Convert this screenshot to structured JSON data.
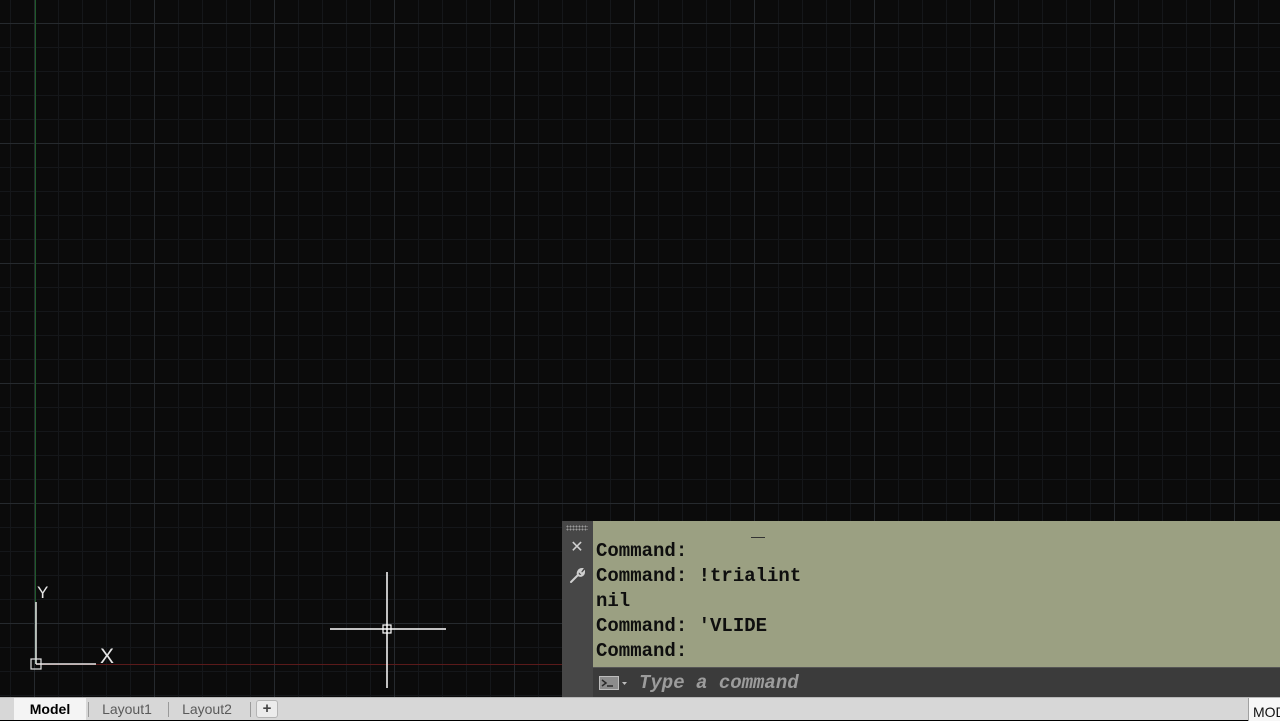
{
  "command_window": {
    "history": [
      {
        "prefix": "Command:",
        "text": ""
      },
      {
        "prefix": "Command:",
        "text": " !trialint"
      },
      {
        "prefix": "",
        "text": "nil"
      },
      {
        "prefix": "Command:",
        "text": " 'VLIDE"
      },
      {
        "prefix": "Command:",
        "text": ""
      }
    ],
    "input_placeholder": "Type a command",
    "close_icon": "close-icon",
    "customize_icon": "wrench-icon",
    "prompt_icon": "command-prompt-icon"
  },
  "ucs": {
    "x_label": "X",
    "y_label": "Y"
  },
  "tabs": [
    {
      "label": "Model",
      "active": true
    },
    {
      "label": "Layout1",
      "active": false
    },
    {
      "label": "Layout2",
      "active": false
    }
  ],
  "add_tab_label": "+",
  "status": {
    "mode_label": "MODEL"
  },
  "colors": {
    "canvas_background": "#0b0b0b",
    "grid_major": "#262a2e",
    "grid_minor": "#15171a",
    "command_history_background": "#9ba082",
    "command_input_background": "#3b3b3b",
    "x_axis": "#5a1a1a",
    "y_axis": "#1f5a2a"
  }
}
